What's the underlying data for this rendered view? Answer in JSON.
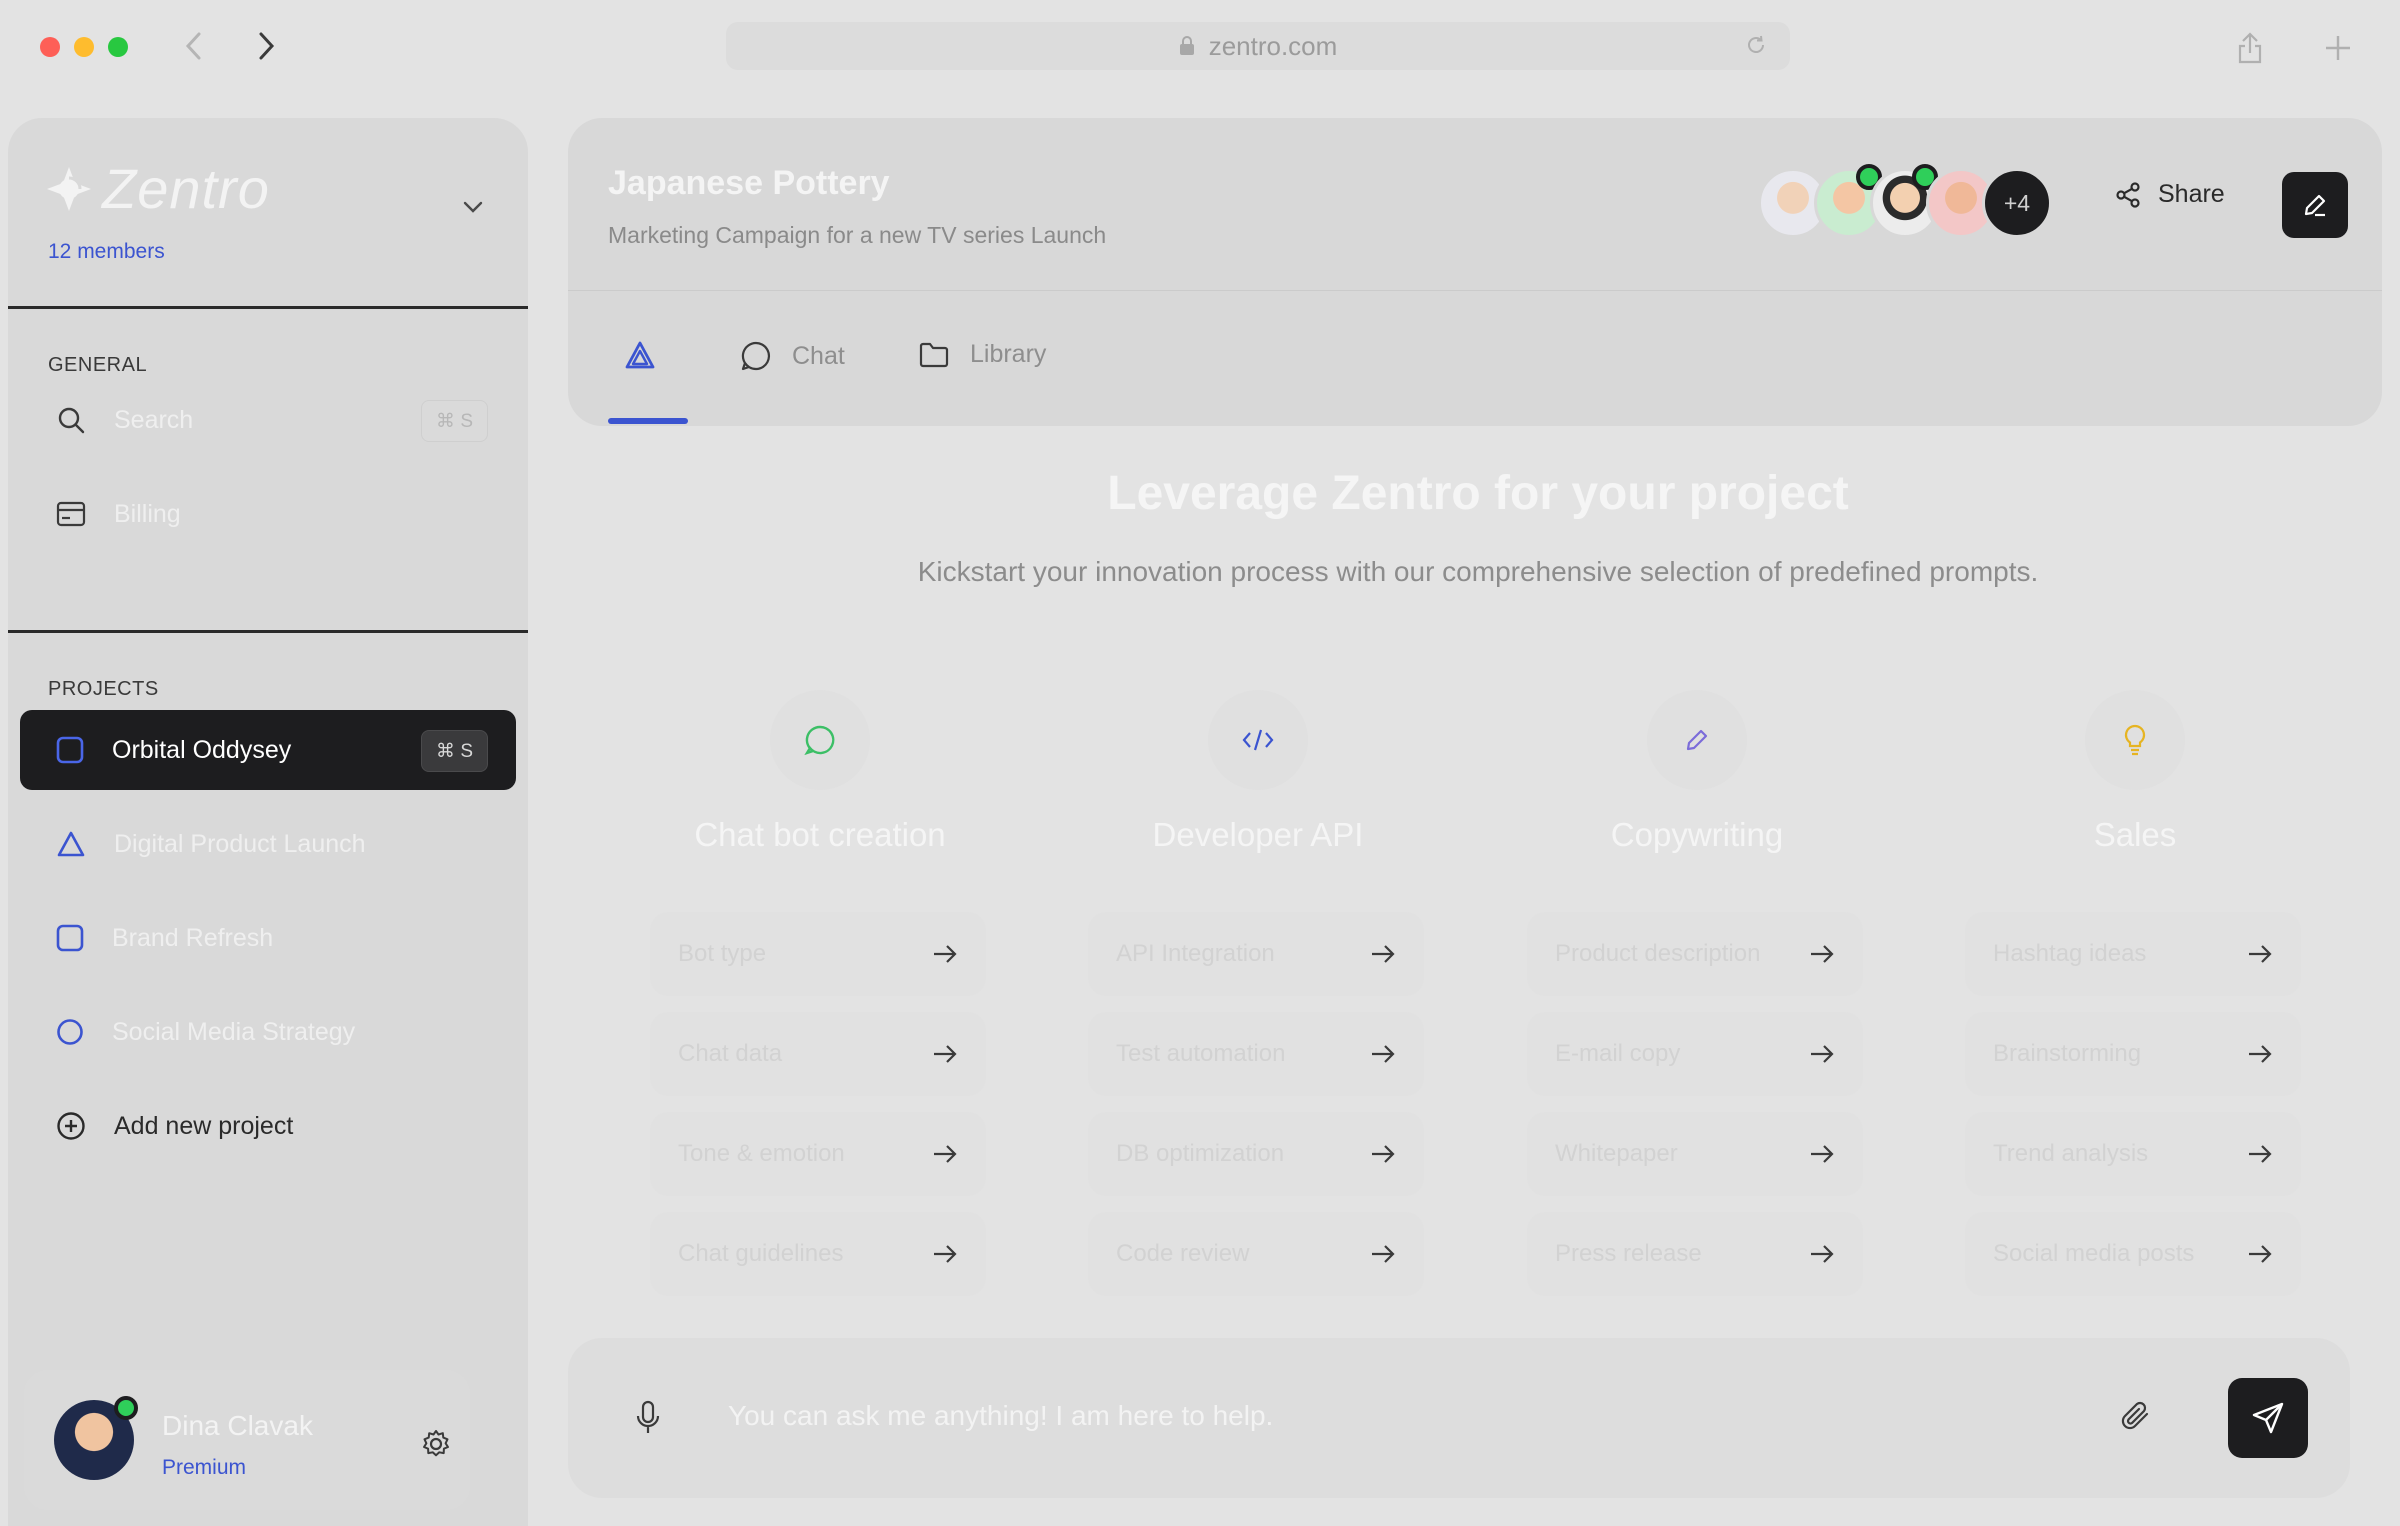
{
  "browser": {
    "url": "zentro.com"
  },
  "sidebar": {
    "brand": "Zentro",
    "members": "12 members",
    "general_label": "GENERAL",
    "general_items": [
      {
        "label": "Search",
        "shortcut": "⌘ S",
        "icon": "search-icon"
      },
      {
        "label": "Billing",
        "icon": "billing-icon"
      }
    ],
    "projects_label": "PROJECTS",
    "projects": [
      {
        "label": "Orbital Oddysey",
        "shortcut": "⌘ S",
        "icon": "square-icon",
        "active": true
      },
      {
        "label": "Digital Product Launch",
        "icon": "triangle-icon"
      },
      {
        "label": "Brand Refresh",
        "icon": "square-icon"
      },
      {
        "label": "Social Media Strategy",
        "icon": "circle-icon"
      }
    ],
    "add_project": "Add new project",
    "user": {
      "name": "Dina Clavak",
      "plan": "Premium"
    }
  },
  "header": {
    "title": "Japanese Pottery",
    "subtitle": "Marketing Campaign for a new TV series Launch",
    "more_members": "+4",
    "share_label": "Share",
    "tabs": [
      {
        "label": "",
        "icon": "prompts-icon",
        "active": true
      },
      {
        "label": "Chat",
        "icon": "chat-icon"
      },
      {
        "label": "Library",
        "icon": "folder-icon"
      }
    ]
  },
  "hero": {
    "title": "Leverage Zentro for your project",
    "subtitle": "Kickstart your innovation process with our comprehensive selection of predefined prompts."
  },
  "categories": [
    {
      "title": "Chat bot creation",
      "icon": "chat-bubble-icon",
      "color": "#3cbf66",
      "prompts": [
        "Bot type",
        "Chat data",
        "Tone & emotion",
        "Chat guidelines"
      ]
    },
    {
      "title": "Developer API",
      "icon": "code-icon",
      "color": "#3b54d0",
      "prompts": [
        "API Integration",
        "Test automation",
        "DB optimization",
        "Code review"
      ]
    },
    {
      "title": "Copywriting",
      "icon": "pencil-icon",
      "color": "#7b6cd9",
      "prompts": [
        "Product description",
        "E-mail copy",
        "Whitepaper",
        "Press release"
      ]
    },
    {
      "title": "Sales",
      "icon": "lightbulb-icon",
      "color": "#e6b422",
      "prompts": [
        "Hashtag ideas",
        "Brainstorming",
        "Trend analysis",
        "Social media posts"
      ]
    }
  ],
  "chat_input": {
    "placeholder": "You can ask me anything! I am here to help."
  },
  "colors": {
    "accent": "#3b54d0",
    "dark": "#1d1d1f",
    "online": "#2fcf5a"
  }
}
